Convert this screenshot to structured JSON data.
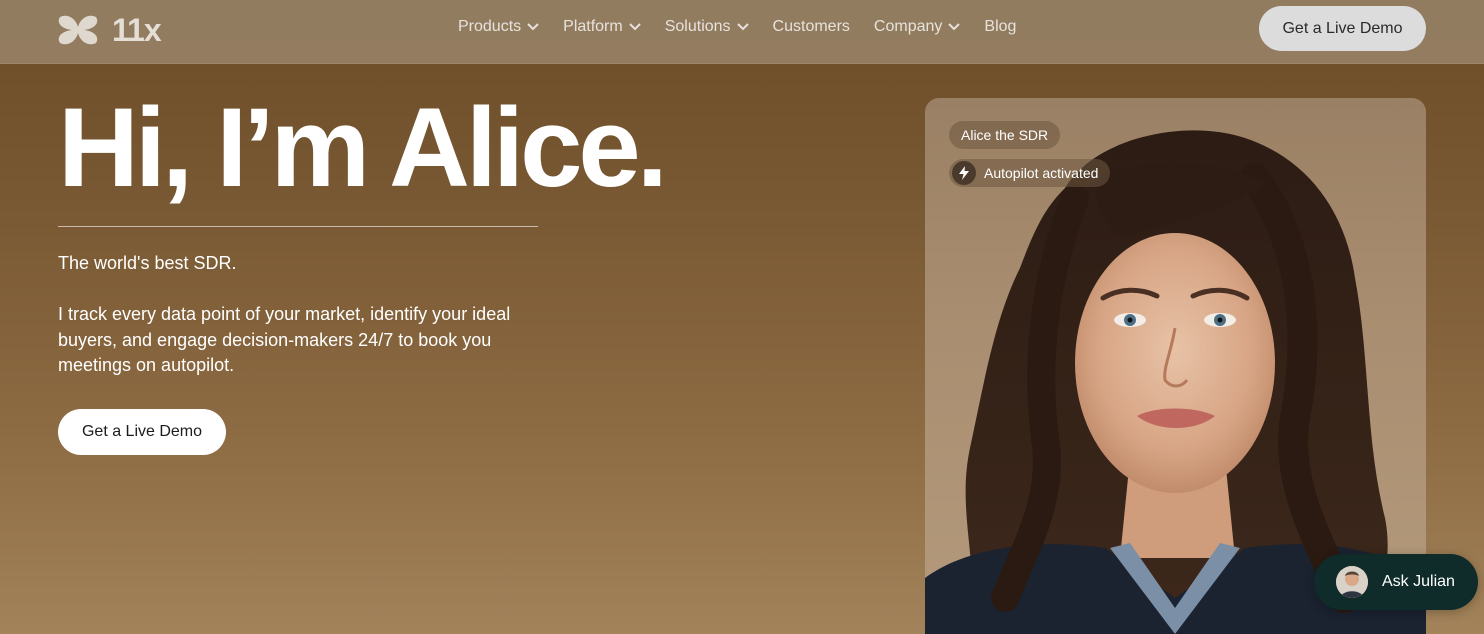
{
  "brand": {
    "name": "11x",
    "logo_icon": "butterfly-logo-icon"
  },
  "nav": {
    "items": [
      {
        "label": "Products",
        "dropdown": true
      },
      {
        "label": "Platform",
        "dropdown": true
      },
      {
        "label": "Solutions",
        "dropdown": true
      },
      {
        "label": "Customers",
        "dropdown": false
      },
      {
        "label": "Company",
        "dropdown": true
      },
      {
        "label": "Blog",
        "dropdown": false
      }
    ],
    "cta_label": "Get a Live Demo"
  },
  "hero": {
    "title": "Hi, I’m Alice.",
    "tagline": "The world's best SDR.",
    "description": "I track every data point of your market, identify your ideal buyers, and engage decision-makers 24/7 to book you meetings on autopilot.",
    "cta_label": "Get a Live Demo"
  },
  "card": {
    "badge_name": "Alice the SDR",
    "badge_status": "Autopilot activated",
    "status_icon": "lightning-bolt-icon"
  },
  "chat": {
    "label": "Ask Julian"
  },
  "colors": {
    "background": "#7a5a34",
    "nav_background": "#96805f",
    "chat_background": "#0f2b2a",
    "button_light": "#ffffff"
  }
}
